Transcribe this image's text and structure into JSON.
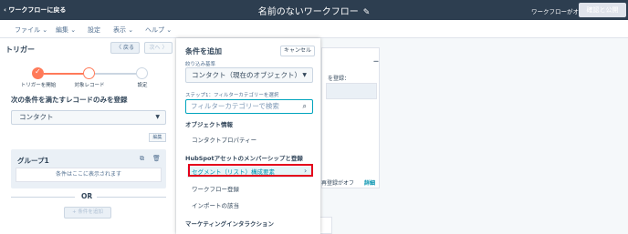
{
  "header": {
    "back_label": "ワークフローに戻る",
    "title": "名前のないワークフロー",
    "status": "ワークフローがオフ",
    "publish_label": "確認と公開"
  },
  "menu": {
    "items": [
      "ファイル ⌄",
      "編集 ⌄",
      "設定",
      "表示 ⌄",
      "ヘルプ ⌄"
    ]
  },
  "left_panel": {
    "title": "トリガー",
    "back_btn": "〈 戻る",
    "next_btn": "次へ 〉",
    "steps": [
      "トリガーを開始",
      "対象レコード",
      "設定"
    ],
    "heading": "次の条件を満たすレコードのみを登録",
    "object_select": "コンタクト",
    "small_btn": "編集",
    "group_title": "グループ1",
    "group_placeholder": "条件はここに表示されます",
    "or_label": "OR",
    "add_filter": "+ 条件を追加"
  },
  "background": {
    "dash": "ー",
    "card_label": "を登録：",
    "bottom_text": "再登録がオフ",
    "detail_link": "詳細"
  },
  "dropdown": {
    "title": "条件を追加",
    "cancel_label": "キャンセル",
    "filter_base_label": "絞り込み基準",
    "filter_base_value": "コンタクト（現在のオブジェクト）",
    "step_label": "ステップ1：フィルターカテゴリーを選択",
    "search_placeholder": "フィルターカテゴリーで検索",
    "section_object": "オブジェクト情報",
    "item_contact_props": "コンタクトプロパティー",
    "section_membership": "HubSpotアセットのメンバーシップと登録",
    "item_segment": "セグメント（リスト）構成要素",
    "item_workflow": "ワークフロー登録",
    "item_import": "インポートの該当",
    "section_marketing": "マーケティングインタラクション"
  }
}
